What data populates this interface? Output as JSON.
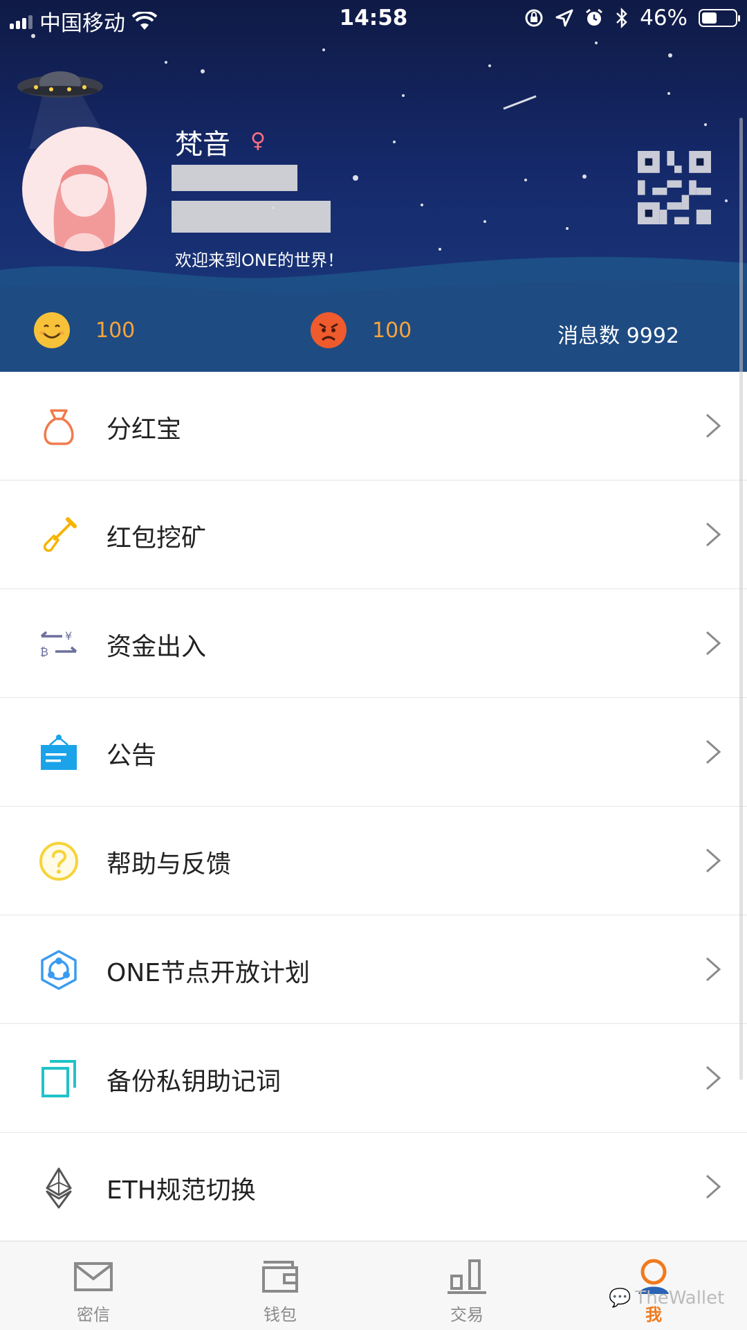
{
  "status_bar": {
    "carrier": "中国移动",
    "time": "14:58",
    "battery": "46%",
    "battery_level": 0.46
  },
  "profile": {
    "username": "梵音",
    "welcome": "欢迎来到ONE的世界！",
    "qr_icon": "qr-code-icon"
  },
  "stats": {
    "smile_value": "100",
    "angry_value": "100",
    "message_count": "消息数 9992"
  },
  "menu": {
    "items": [
      {
        "label": "分红宝",
        "icon": "money-bag-icon",
        "color": "#f07a4c"
      },
      {
        "label": "红包挖矿",
        "icon": "shovel-icon",
        "color": "#f5b400"
      },
      {
        "label": "资金出入",
        "icon": "exchange-icon",
        "color": "#6a6f9c"
      },
      {
        "label": "公告",
        "icon": "notice-board-icon",
        "color": "#1aa3e8"
      },
      {
        "label": "帮助与反馈",
        "icon": "help-icon",
        "color": "#f7d338"
      },
      {
        "label": "ONE节点开放计划",
        "icon": "node-network-icon",
        "color": "#3a9bf0"
      },
      {
        "label": "备份私钥助记词",
        "icon": "copy-icon",
        "color": "#1fc3c8"
      },
      {
        "label": "ETH规范切换",
        "icon": "ethereum-icon",
        "color": "#555555"
      }
    ]
  },
  "tabbar": {
    "tabs": [
      {
        "label": "密信",
        "icon": "mail-icon"
      },
      {
        "label": "钱包",
        "icon": "wallet-icon"
      },
      {
        "label": "交易",
        "icon": "chart-icon"
      },
      {
        "label": "我",
        "icon": "profile-icon"
      }
    ],
    "active_color": "#f07a1d"
  },
  "watermark": "TheWallet"
}
